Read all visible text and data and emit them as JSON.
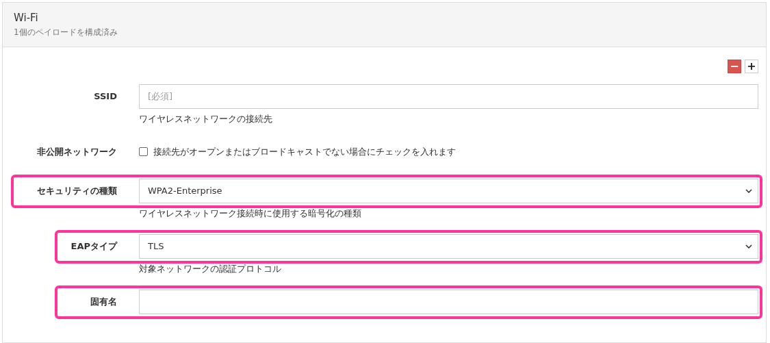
{
  "panel": {
    "title": "Wi-Fi",
    "subtitle": "1個のペイロードを構成済み"
  },
  "payload_buttons": [
    {
      "kind": "remove",
      "label": "−"
    },
    {
      "kind": "add",
      "label": "+"
    }
  ],
  "rows": [
    {
      "kind": "text",
      "label": "SSID",
      "placeholder": "[必須]",
      "help": "ワイヤレスネットワークの接続先",
      "highlighted": false
    },
    {
      "kind": "checkbox",
      "label": "非公開ネットワーク",
      "checked": false,
      "text": "接続先がオープンまたはブロードキャストでない場合にチェックを入れます",
      "highlighted": false
    },
    {
      "kind": "select",
      "label": "セキュリティの種類",
      "value": "WPA2-Enterprise",
      "help": "ワイヤレスネットワーク接続時に使用する暗号化の種類",
      "highlighted": true,
      "indented": false
    },
    {
      "kind": "select",
      "label": "EAPタイプ",
      "value": "TLS",
      "help": "対象ネットワークの認証プロトコル",
      "highlighted": true,
      "indented": true
    },
    {
      "kind": "text",
      "label": "固有名",
      "highlighted": true,
      "indented": true
    }
  ]
}
